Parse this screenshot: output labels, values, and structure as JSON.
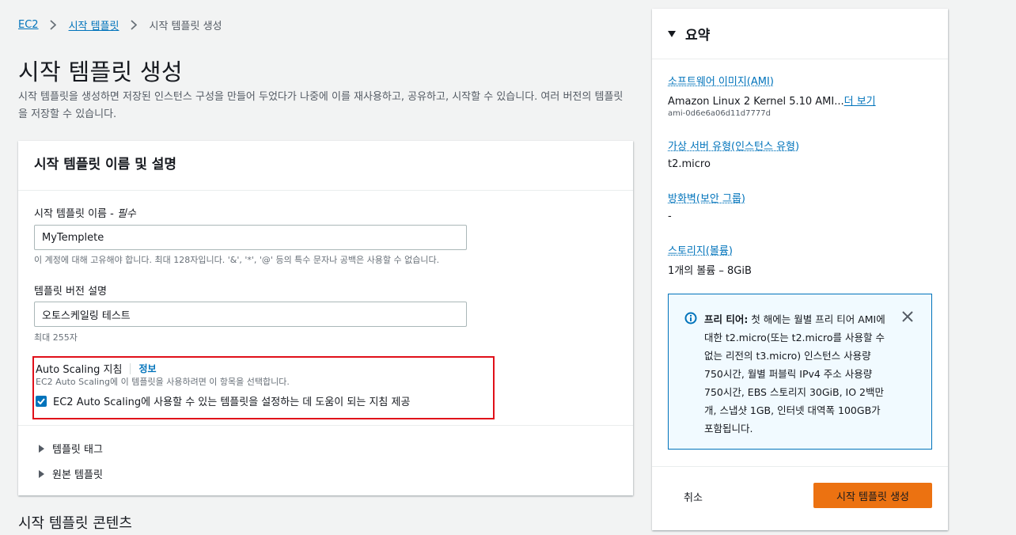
{
  "breadcrumb": {
    "items": [
      "EC2",
      "시작 템플릿"
    ],
    "current": "시작 템플릿 생성"
  },
  "page": {
    "title": "시작 템플릿 생성",
    "description": "시작 템플릿을 생성하면 저장된 인스턴스 구성을 만들어 두었다가 나중에 이를 재사용하고, 공유하고, 시작할 수 있습니다. 여러 버전의 템플릿을 저장할 수 있습니다."
  },
  "form": {
    "title": "시작 템플릿 이름 및 설명",
    "name_label": "시작 템플릿 이름 - ",
    "name_required": "필수",
    "name_value": "MyTemplete",
    "name_hint": "이 계정에 대해 고유해야 합니다. 최대 128자입니다. '&', '*', '@' 등의 특수 문자나 공백은 사용할 수 없습니다.",
    "version_label": "템플릿 버전 설명",
    "version_value": "오토스케일링 테스트",
    "version_hint": "최대 255자",
    "asg": {
      "label": "Auto Scaling 지침",
      "info": "정보",
      "hint": "EC2 Auto Scaling에 이 템플릿을 사용하려면 이 항목을 선택합니다.",
      "checkbox_label": "EC2 Auto Scaling에 사용할 수 있는 템플릿을 설정하는 데 도움이 되는 지침 제공",
      "checked": true
    },
    "expanders": [
      "템플릿 태그",
      "원본 템플릿"
    ]
  },
  "next_section_title": "시작 템플릿 콘텐츠",
  "summary": {
    "title": "요약",
    "ami_label": "소프트웨어 이미지(AMI)",
    "ami_value": "Amazon Linux 2 Kernel 5.10 AMI...",
    "ami_more": "더 보기",
    "ami_id": "ami-0d6e6a06d11d7777d",
    "type_label": "가상 서버 유형(인스턴스 유형)",
    "type_value": "t2.micro",
    "sg_label": "방화벽(보안 그룹)",
    "sg_value": "-",
    "storage_label": "스토리지(볼륨)",
    "storage_value": "1개의 볼륨 – 8GiB",
    "free_tier": {
      "title": "프리 티어:",
      "text": " 첫 해에는 월별 프리 티어 AMI에 대한 t2.micro(또는 t2.micro를 사용할 수 없는 리전의 t3.micro) 인스턴스 사용량 750시간, 월별 퍼블릭 IPv4 주소 사용량 750시간, EBS 스토리지 30GiB, IO 2백만 개, 스냅샷 1GB, 인터넷 대역폭 100GB가 포함됩니다."
    },
    "cancel_label": "취소",
    "create_label": "시작 템플릿 생성"
  },
  "colors": {
    "link": "#0073bb",
    "primary_button": "#ec7211",
    "highlight_border": "#e0101a",
    "info_bg": "#f1faff"
  }
}
